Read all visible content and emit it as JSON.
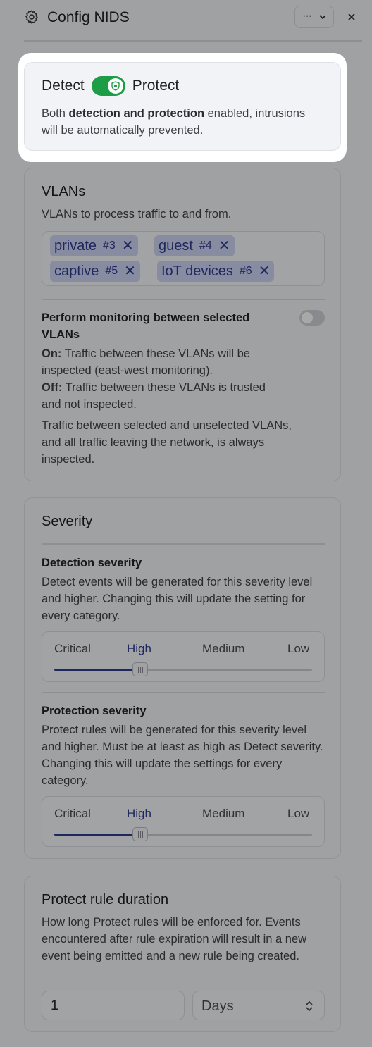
{
  "header": {
    "title": "Config NIDS",
    "more_label": "···"
  },
  "mode": {
    "detect_label": "Detect",
    "protect_label": "Protect",
    "toggle_on": true,
    "desc_prefix": "Both ",
    "desc_bold": "detection and protection",
    "desc_suffix": " enabled, intrusions will be automatically prevented.",
    "accent": "#1d9e46"
  },
  "vlans": {
    "title": "VLANs",
    "subtitle": "VLANs to process traffic to and from.",
    "tags": [
      {
        "name": "private",
        "num": "#3"
      },
      {
        "name": "guest",
        "num": "#4"
      },
      {
        "name": "captive",
        "num": "#5"
      },
      {
        "name": "IoT devices",
        "num": "#6"
      }
    ],
    "monitor_title": "Perform monitoring between selected VLANs",
    "monitor_toggle_on": false,
    "on_label": "On:",
    "on_text": " Traffic between these VLANs will be inspected (east-west monitoring).",
    "off_label": "Off:",
    "off_text": " Traffic between these VLANs is trusted and not inspected.",
    "note": "Traffic between selected and unselected VLANs, and all traffic leaving the network, is always inspected."
  },
  "severity": {
    "title": "Severity",
    "detection_title": "Detection severity",
    "detection_desc": "Detect events will be generated for this severity level and higher. Changing this will update the setting for every category.",
    "protection_title": "Protection severity",
    "protection_desc": "Protect rules will be generated for this severity level and higher. Must be at least as high as Detect severity. Changing this will update the settings for every category.",
    "levels": [
      "Critical",
      "High",
      "Medium",
      "Low"
    ],
    "detection_selected": "High",
    "protection_selected": "High"
  },
  "duration": {
    "title": "Protect rule duration",
    "desc": "How long Protect rules will be enforced for. Events encountered after rule expiration will result in a new event being emitted and a new rule being created.",
    "value": "1",
    "unit": "Days"
  }
}
